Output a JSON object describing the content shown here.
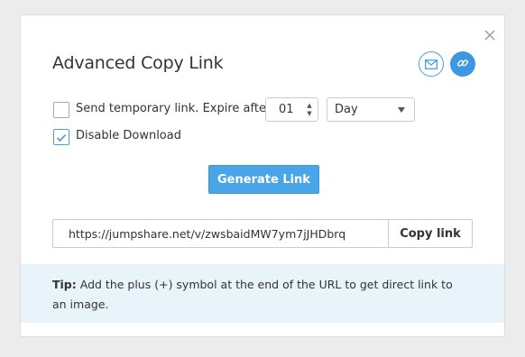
{
  "dialog": {
    "title": "Advanced Copy Link",
    "close_icon": "close-icon",
    "email_icon": "envelope-icon",
    "link_icon": "chain-link-icon",
    "accent_color": "#4aa5e8"
  },
  "options": {
    "temporary_link": {
      "label": "Send temporary link. Expire after",
      "checked": false,
      "duration_value": "01",
      "unit_selected": "Day"
    },
    "disable_download": {
      "label": "Disable Download",
      "checked": true
    }
  },
  "generate_button": {
    "label": "Generate Link"
  },
  "link": {
    "url": "https://jumpshare.net/v/zwsbaidMW7ym7jJHDbrq",
    "copy_label": "Copy link"
  },
  "tip": {
    "label": "Tip:",
    "text": " Add the plus (+) symbol at the end of the URL to get direct link to an image."
  }
}
